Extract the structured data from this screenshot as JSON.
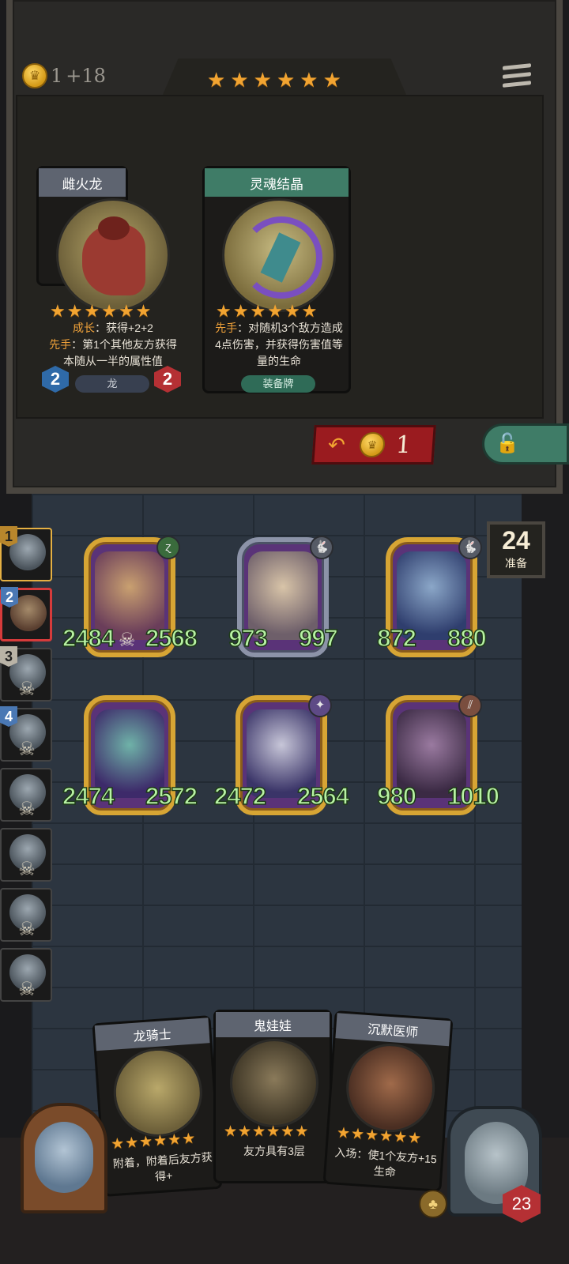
{
  "shop": {
    "gold_amount": "1",
    "gold_income": "+18",
    "tier_stars": 6,
    "refresh_cost": "1"
  },
  "shop_cards": [
    {
      "name": "雌火龙",
      "stars": 6,
      "keyword1": "成长",
      "text1": "：获得+2+2",
      "keyword2": "先手",
      "text2": "：第1个其他友方获得本随从一半的属性值",
      "tribe": "龙",
      "attack": "2",
      "health": "2"
    },
    {
      "name": "灵魂结晶",
      "stars": 6,
      "keyword1": "先手",
      "text1": "：对随机3个敌方造成4点伤害，并获得伤害值等量的生命",
      "tribe": "装备牌"
    }
  ],
  "timer": {
    "value": "24",
    "label": "准备"
  },
  "players": [
    {
      "rank": "1",
      "state": "me"
    },
    {
      "rank": "2",
      "state": "opponent"
    },
    {
      "rank": "3",
      "state": "dead"
    },
    {
      "rank": "4",
      "state": "dead"
    },
    {
      "rank": "",
      "state": "dead"
    },
    {
      "rank": "",
      "state": "dead"
    },
    {
      "rank": "",
      "state": "dead"
    },
    {
      "rank": "",
      "state": "dead"
    }
  ],
  "board": [
    {
      "attack": "2484",
      "health": "2568",
      "tribe_icon": "nature"
    },
    {
      "attack": "973",
      "health": "997",
      "tribe_icon": "beast"
    },
    {
      "attack": "872",
      "health": "880",
      "tribe_icon": "beast"
    },
    {
      "attack": "2474",
      "health": "2572",
      "tribe_icon": ""
    },
    {
      "attack": "2472",
      "health": "2564",
      "tribe_icon": "arcane"
    },
    {
      "attack": "980",
      "health": "1010",
      "tribe_icon": "claw"
    }
  ],
  "hand": [
    {
      "name": "龙骑士",
      "stars": 6,
      "text": "附着，附着后友方获得+"
    },
    {
      "name": "鬼娃娃",
      "stars": 6,
      "text": "友方具有3层"
    },
    {
      "name": "沉默医师",
      "stars": 6,
      "text": "入场：使1个友方+15生命"
    }
  ],
  "hero": {
    "health": "23"
  },
  "colors": {
    "gold": "#f2a431",
    "stat_green": "#b8f2a4",
    "red": "#b53034",
    "blue": "#2f6aa8"
  }
}
